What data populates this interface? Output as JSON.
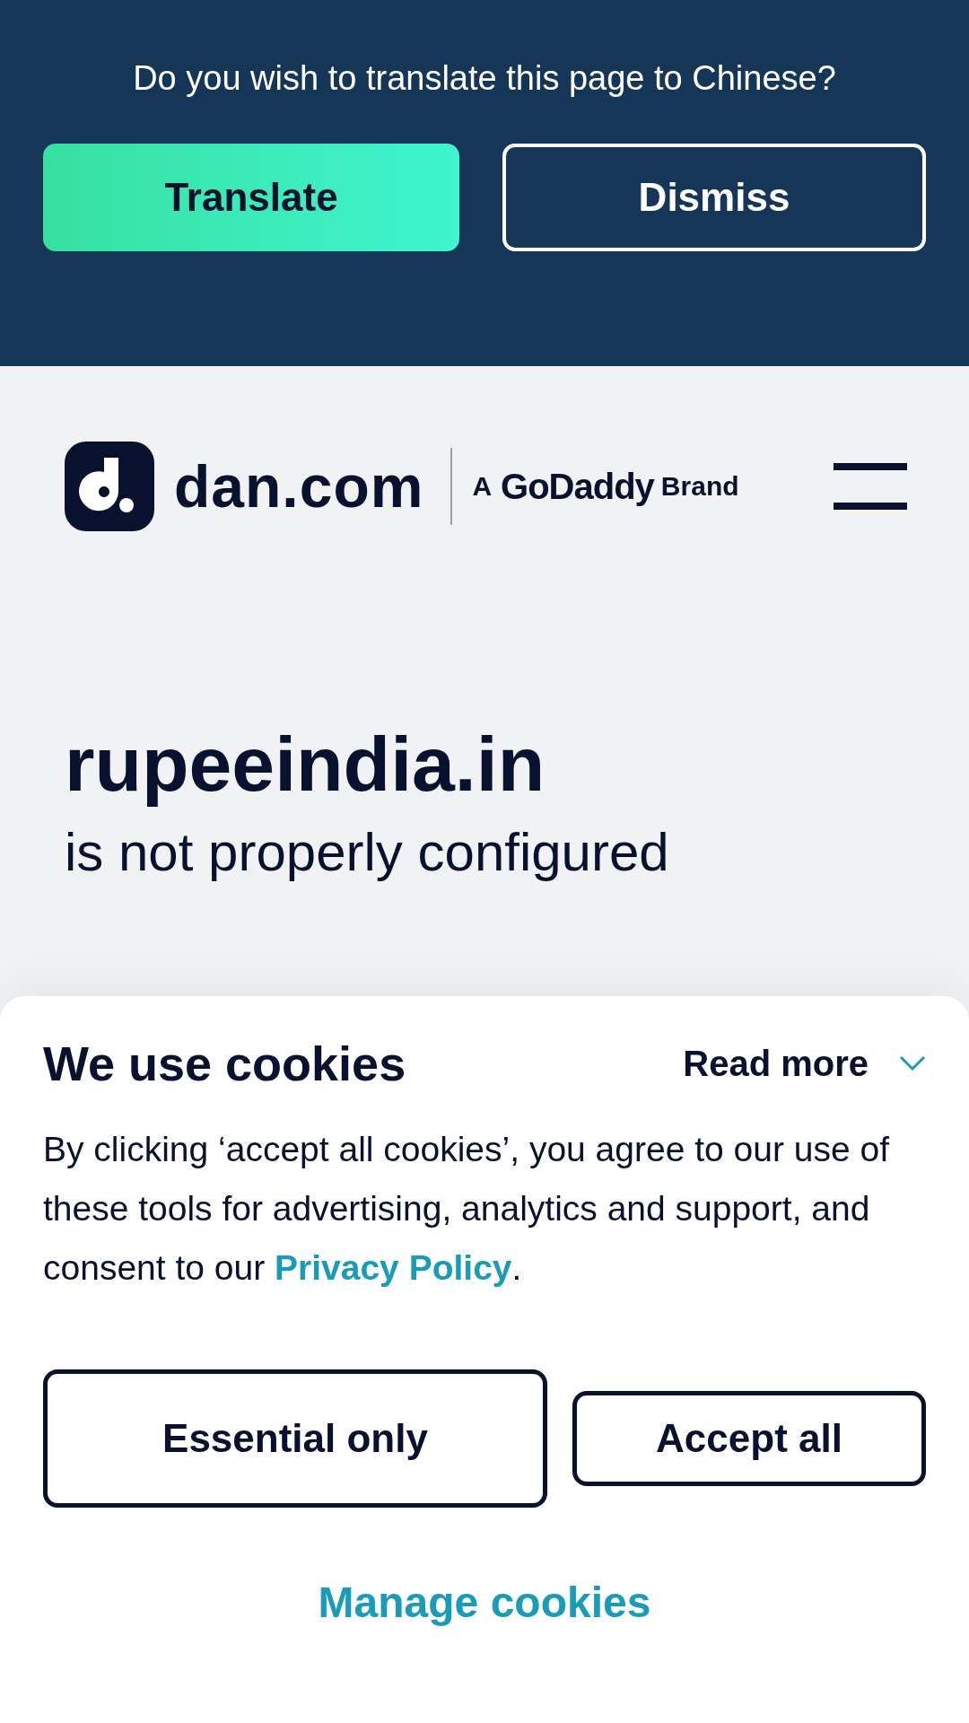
{
  "translate_banner": {
    "message": "Do you wish to translate this page to Chinese?",
    "buttons": [
      {
        "label": "Translate",
        "kind": "primary"
      },
      {
        "label": "Dismiss",
        "kind": "outline"
      }
    ]
  },
  "header": {
    "logo_text": "dan.com",
    "brand_prefix": "A",
    "brand_name": "GoDaddy",
    "brand_suffix": "Brand"
  },
  "domain": {
    "name": "rupeeindia.in",
    "status": "is not properly configured"
  },
  "cookie_banner": {
    "title": "We use cookies",
    "read_more": "Read more",
    "read_more_expanded": false,
    "body": "By clicking ‘accept all cookies’, you agree to our use of these tools for advertising, analytics and support, and consent to our",
    "link": "Privacy Policy",
    "body_end": ".",
    "buttons": [
      {
        "label": "Essential only",
        "kind": "outline"
      },
      {
        "label": "Accept all",
        "kind": "outline"
      }
    ],
    "manage": "Manage cookies"
  }
}
